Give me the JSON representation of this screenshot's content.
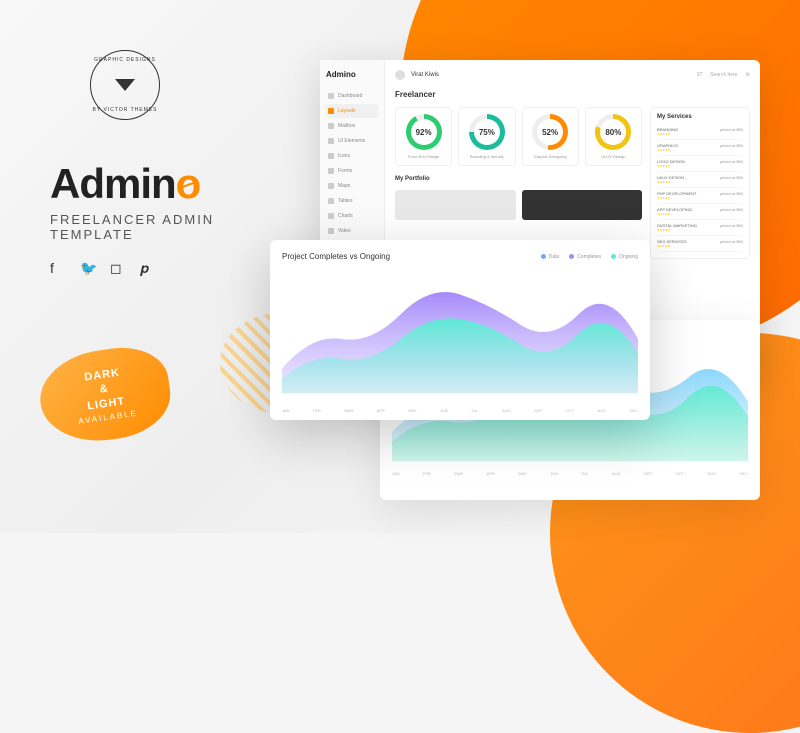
{
  "badge": {
    "top": "GRAPHIC DESIGNS",
    "bottom": "BY VICTOR THEMES"
  },
  "brand": {
    "name": "Admin",
    "accent": "o",
    "subtitle": "FREELANCER ADMIN\nTEMPLATE"
  },
  "brush": {
    "line1": "DARK",
    "amp": "&",
    "line2": "LIGHT",
    "sub": "AVAILABLE"
  },
  "dashboard": {
    "logo": "Admino",
    "user": "Virat Kiwis",
    "search": "Search here",
    "nav": [
      {
        "label": "Dashboard",
        "active": false
      },
      {
        "label": "Layouts",
        "active": true
      },
      {
        "label": "Mailbox",
        "active": false
      },
      {
        "label": "UI Elements",
        "active": false
      },
      {
        "label": "Icons",
        "active": false
      },
      {
        "label": "Forms",
        "active": false
      },
      {
        "label": "Maps",
        "active": false
      },
      {
        "label": "Tables",
        "active": false
      },
      {
        "label": "Charts",
        "active": false
      },
      {
        "label": "Video",
        "active": false
      }
    ],
    "section": "Freelancer",
    "metrics": [
      {
        "value": "92%",
        "label": "Front-End Design"
      },
      {
        "value": "75%",
        "label": "Branding & Identity"
      },
      {
        "value": "52%",
        "label": "Graphic Designing"
      },
      {
        "value": "80%",
        "label": "UI/UX Design"
      }
    ],
    "portfolio_title": "My Portfolio",
    "services": {
      "title": "My Services",
      "items": [
        {
          "name": "BRANDING",
          "price": "$50"
        },
        {
          "name": "GRAPHICS",
          "price": "$90"
        },
        {
          "name": "LOGO DESIGN",
          "price": "$60"
        },
        {
          "name": "UI/UX DESIGN",
          "price": "$85"
        },
        {
          "name": "PHP DEVELOPMENT",
          "price": "$60"
        },
        {
          "name": "APP DEVELOPING",
          "price": "$60"
        },
        {
          "name": "DIGITAL MARKETING",
          "price": "$60"
        },
        {
          "name": "SEO SERVICES",
          "price": "$60"
        }
      ]
    }
  },
  "chart": {
    "title": "Project Completes vs Ongoing",
    "legend": [
      {
        "label": "Data",
        "color": "#7b9fff"
      },
      {
        "label": "Completes",
        "color": "#a78bfa"
      },
      {
        "label": "Ongoing",
        "color": "#5eead4"
      }
    ]
  },
  "chart_data": {
    "type": "area",
    "categories": [
      "JAN",
      "FEB",
      "MAR",
      "APR",
      "MAY",
      "JUN",
      "JUL",
      "AUG",
      "SEP",
      "OCT",
      "NOV",
      "DEC"
    ],
    "ylim": [
      0,
      1200
    ],
    "series": [
      {
        "name": "Completes",
        "values": [
          200,
          350,
          550,
          400,
          700,
          500,
          900,
          650,
          750,
          500,
          600,
          400
        ]
      },
      {
        "name": "Ongoing",
        "values": [
          150,
          250,
          400,
          300,
          500,
          350,
          650,
          450,
          550,
          350,
          450,
          300
        ]
      }
    ]
  }
}
